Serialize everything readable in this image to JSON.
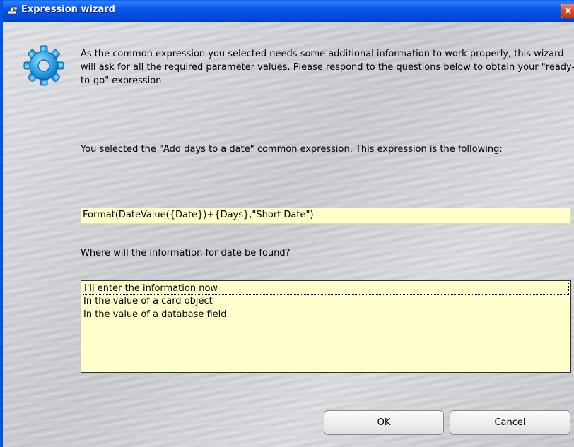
{
  "window": {
    "title": "Expression wizard"
  },
  "intro_text": "As the common expression you selected needs some additional information to work properly, this wizard will ask for all the required parameter values. Please respond to the questions below to obtain your \"ready-to-go\" expression.",
  "selected_text": "You selected the \"Add days to a date\" common expression. This expression is the following:",
  "expression": "Format(DateValue({Date})+{Days},\"Short Date\")",
  "question": "Where will the information for date be found?",
  "options": [
    {
      "label": "I'll enter the information now",
      "selected": true
    },
    {
      "label": "In the value of a card object",
      "selected": false
    },
    {
      "label": "In the value of a database field",
      "selected": false
    }
  ],
  "buttons": {
    "ok": "OK",
    "cancel": "Cancel"
  },
  "colors": {
    "titlebar": "#0a58e8",
    "field_background": "#ffffcc",
    "close_button": "#d8471f",
    "gear_icon": "#2a9fe8"
  },
  "icons": {
    "title": "wizard-icon",
    "main": "gear-icon",
    "close": "close-icon"
  }
}
